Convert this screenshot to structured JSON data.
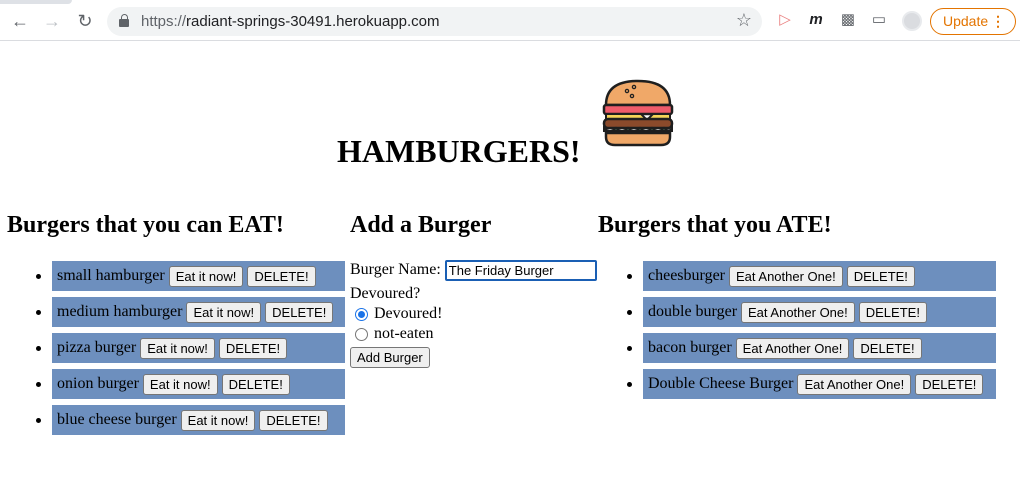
{
  "browser": {
    "url_prefix": "https://",
    "url_host": "radiant-springs-30491.herokuapp.com",
    "update_label": "Update"
  },
  "page": {
    "title": "HAMBURGERS!",
    "eat_heading": "Burgers that you can EAT!",
    "add_heading": "Add a Burger",
    "ate_heading": "Burgers that you ATE!",
    "uneaten": [
      {
        "name": "small hamburger",
        "action": "Eat it now!",
        "delete": "DELETE!"
      },
      {
        "name": "medium hamburger",
        "action": "Eat it now!",
        "delete": "DELETE!"
      },
      {
        "name": "pizza burger",
        "action": "Eat it now!",
        "delete": "DELETE!"
      },
      {
        "name": "onion burger",
        "action": "Eat it now!",
        "delete": "DELETE!"
      },
      {
        "name": "blue cheese burger",
        "action": "Eat it now!",
        "delete": "DELETE!"
      }
    ],
    "eaten": [
      {
        "name": "cheesburger",
        "action": "Eat Another One!",
        "delete": "DELETE!"
      },
      {
        "name": "double burger",
        "action": "Eat Another One!",
        "delete": "DELETE!"
      },
      {
        "name": "bacon burger",
        "action": "Eat Another One!",
        "delete": "DELETE!"
      },
      {
        "name": "Double Cheese Burger",
        "action": "Eat Another One!",
        "delete": "DELETE!"
      }
    ],
    "form": {
      "name_label": "Burger Name:",
      "name_value": "The Friday Burger",
      "devoured_label": "Devoured?",
      "option_devoured": "Devoured!",
      "option_not_eaten": "not-eaten",
      "selected": "Devoured!",
      "submit_label": "Add Burger"
    }
  },
  "colors": {
    "list_item_bg": "#6d8fbe",
    "update_accent": "#e37400"
  }
}
